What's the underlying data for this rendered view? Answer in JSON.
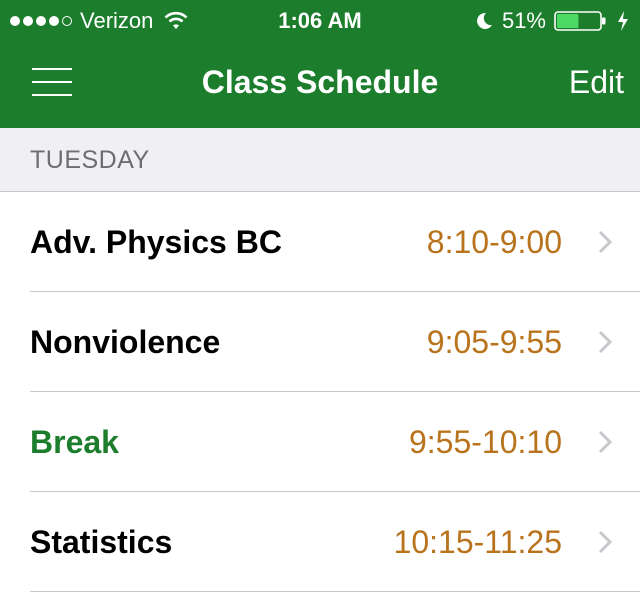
{
  "status_bar": {
    "carrier": "Verizon",
    "signal_bars_filled": 4,
    "signal_bars_total": 5,
    "time": "1:06 AM",
    "battery_percent": "51%",
    "battery_level": 0.51
  },
  "nav": {
    "title": "Class Schedule",
    "edit_label": "Edit"
  },
  "section": {
    "day": "TUESDAY"
  },
  "schedule": [
    {
      "name": "Adv. Physics BC",
      "time": "8:10-9:00",
      "is_break": false
    },
    {
      "name": "Nonviolence",
      "time": "9:05-9:55",
      "is_break": false
    },
    {
      "name": "Break",
      "time": "9:55-10:10",
      "is_break": true
    },
    {
      "name": "Statistics",
      "time": "10:15-11:25",
      "is_break": false
    }
  ],
  "colors": {
    "brand_green": "#1c7d2c",
    "time_orange": "#b8731c",
    "section_bg": "#efeff4"
  }
}
